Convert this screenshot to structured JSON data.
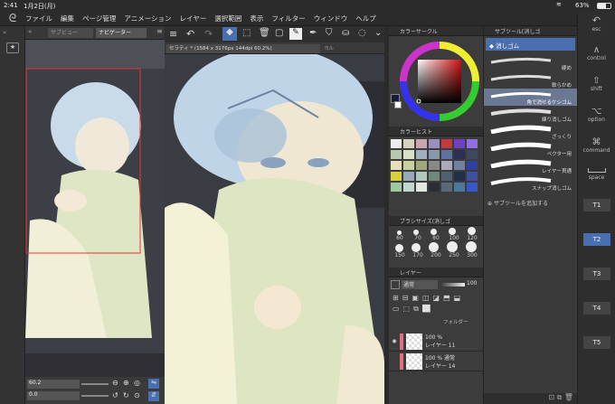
{
  "status": {
    "time": "2:41",
    "date": "1月2日(月)",
    "battery": "63%"
  },
  "menu": [
    "ファイル",
    "編集",
    "ページ管理",
    "アニメーション",
    "レイヤー",
    "選択範囲",
    "表示",
    "フィルター",
    "ウィンドウ",
    "ヘルプ"
  ],
  "nav_tabs": [
    "サブビュー",
    "ナビゲーター"
  ],
  "canvas_tab": "セラティ * (1584 x 3176px 144dpi 60.2%)",
  "canvas_tab2": "ヨル",
  "zoom": {
    "value": "60.2",
    "rotate": "0.0"
  },
  "panels": {
    "color_circle": "カラーサークル",
    "color_history": "カラーヒスト",
    "brush_size": "ブラシサイズ(消しゴ",
    "layer": "レイヤー",
    "sub_tool": "サブツール[消しゴ"
  },
  "brush_sizes": [
    "60",
    "70",
    "80",
    "100",
    "120",
    "150",
    "170",
    "200",
    "250",
    "300"
  ],
  "sub_tool_group": "消しゴム",
  "sub_tools": [
    "硬め",
    "軟らかめ",
    "角で消せるケシゴム",
    "練り消しゴム",
    "ざっくり",
    "ベクター用",
    "レイヤー貫通",
    "スナップ消しゴム"
  ],
  "add_sub_tool": "サブツールを追加する",
  "layer": {
    "blend": "通常",
    "opacity": "100",
    "folder": "フォルダー",
    "rows": [
      {
        "pct": "100 %",
        "mode": "",
        "name": "レイヤー 11"
      },
      {
        "pct": "100 %",
        "mode": "通常",
        "name": "レイヤー 14"
      }
    ]
  },
  "keys": [
    "esc",
    "control",
    "shift",
    "option",
    "command",
    "space"
  ],
  "shortcuts": [
    "T1",
    "T2",
    "T3",
    "T4",
    "T5"
  ],
  "colors": {
    "accent": "#4a6fb0",
    "bg": "#3b3b3b",
    "panel": "#3c3c3c"
  }
}
